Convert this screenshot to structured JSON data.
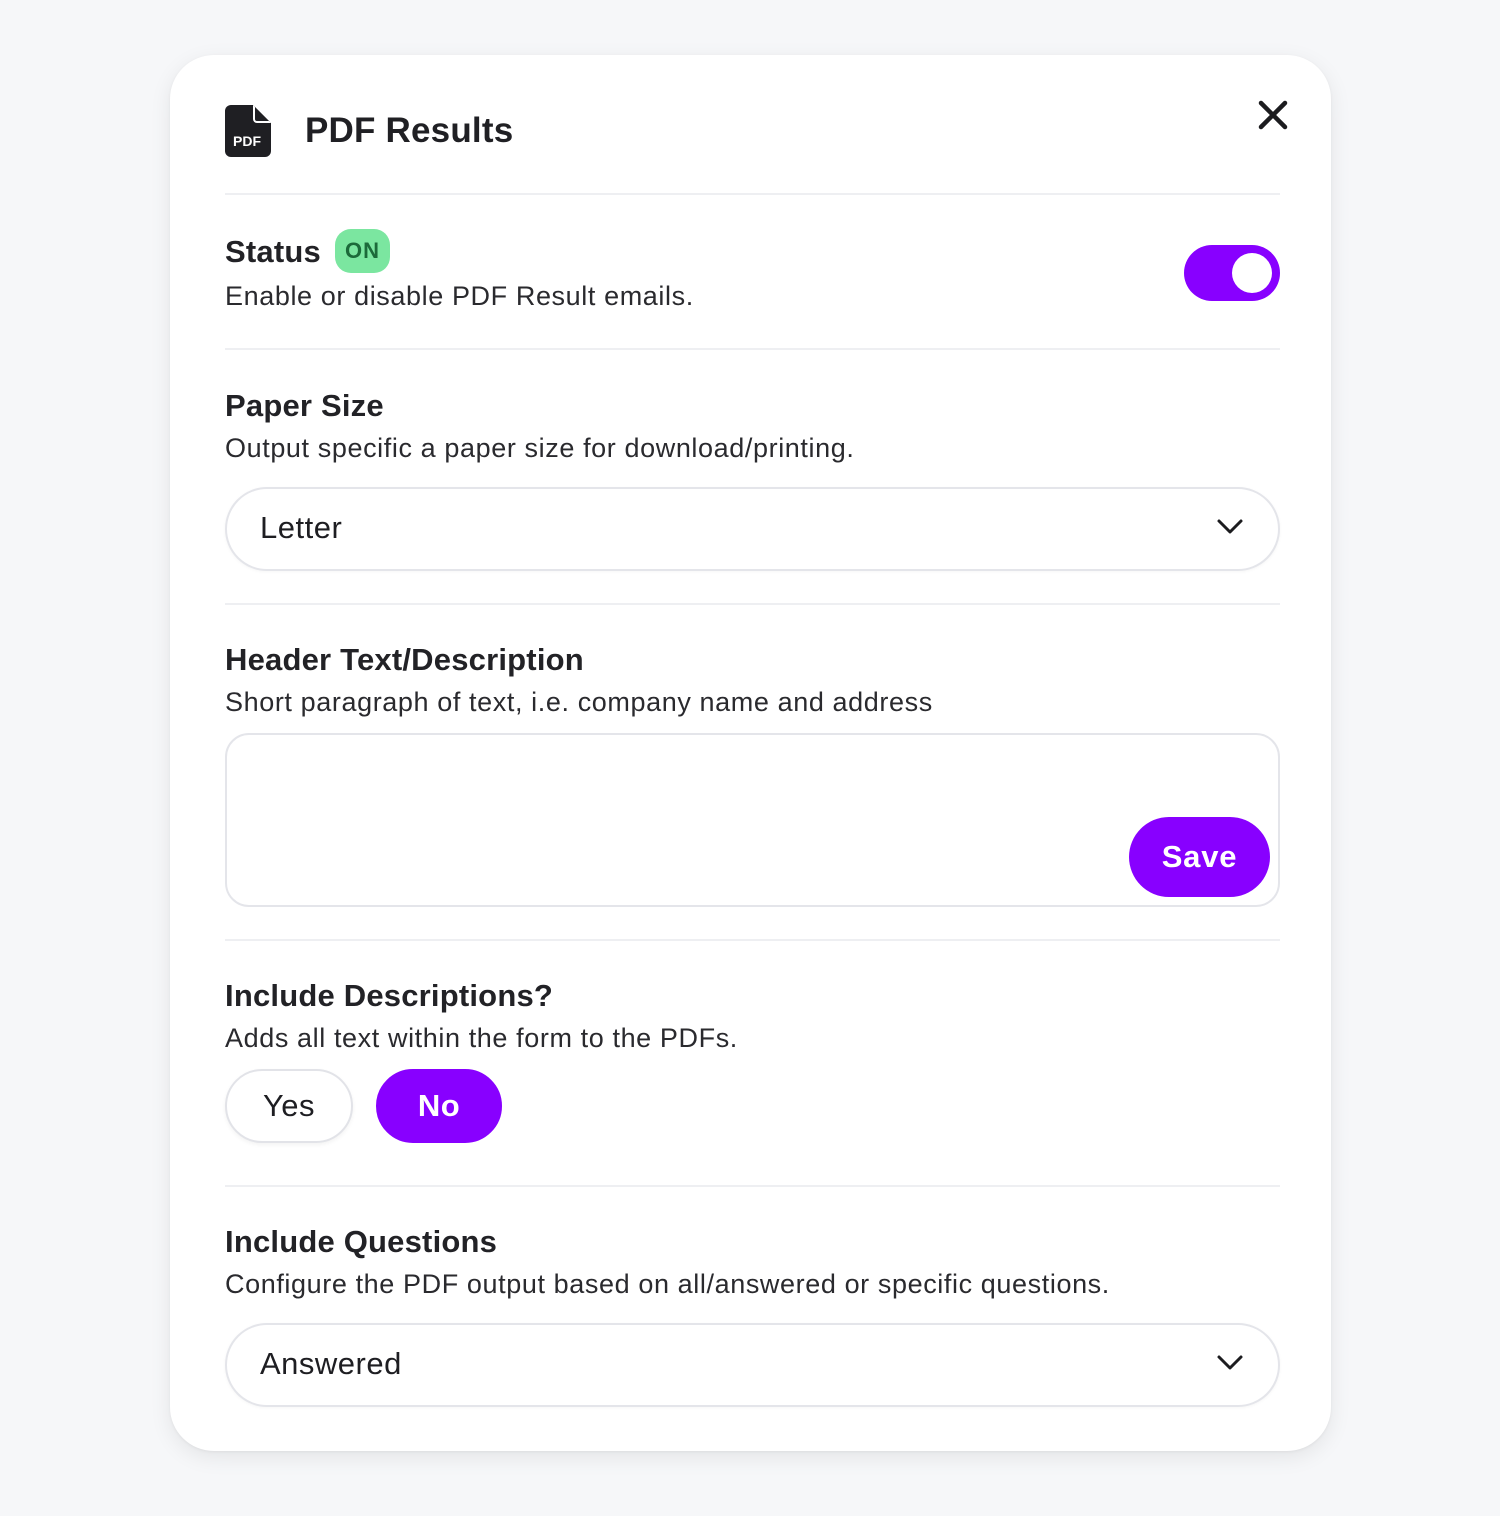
{
  "header": {
    "title": "PDF Results",
    "icon": "pdf-file-icon",
    "icon_label": "PDF",
    "close_icon": "close-icon"
  },
  "status": {
    "title": "Status",
    "badge": "ON",
    "description": "Enable or disable PDF Result emails.",
    "toggle_on": true
  },
  "paper_size": {
    "title": "Paper Size",
    "description": "Output specific a paper size for download/printing.",
    "selected": "Letter"
  },
  "header_text": {
    "title": "Header Text/Description",
    "description": "Short paragraph of text, i.e. company name and address",
    "value": "",
    "save_label": "Save"
  },
  "include_descriptions": {
    "title": "Include Descriptions?",
    "description": "Adds all text within the form to the PDFs.",
    "yes_label": "Yes",
    "no_label": "No",
    "selected": "No"
  },
  "include_questions": {
    "title": "Include Questions",
    "description": "Configure the PDF output based on all/answered or specific questions.",
    "selected": "Answered"
  },
  "colors": {
    "accent": "#8800ff",
    "badge_bg": "#7be6a0",
    "badge_text": "#1c6a3a"
  }
}
